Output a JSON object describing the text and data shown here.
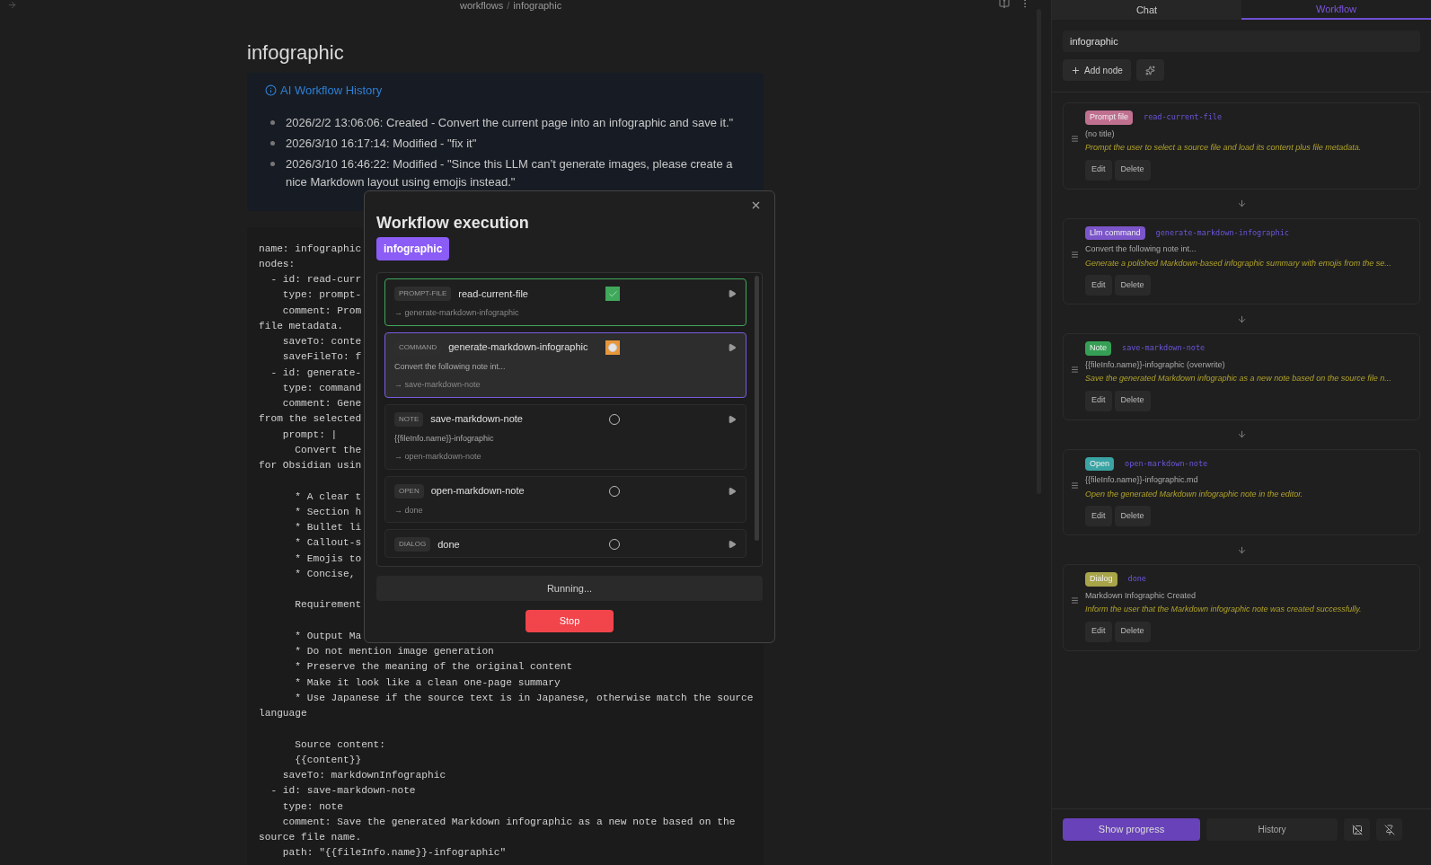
{
  "breadcrumb": {
    "folder": "workflows",
    "separator": "/",
    "file": "infographic"
  },
  "note": {
    "title": "infographic",
    "callout": {
      "title": "AI Workflow History",
      "items": [
        "2026/2/2 13:06:06: Created - Convert the current page into an infographic and save it.\"",
        "2026/3/10 16:17:14: Modified - \"fix it\"",
        "2026/3/10 16:46:22: Modified - \"Since this LLM can’t generate images, please create a nice Markdown layout using emojis instead.\""
      ]
    },
    "code_lines": [
      {
        "text": "name: infographic",
        "gap_before": false
      },
      {
        "text": "nodes:",
        "gap_before": false
      },
      {
        "text": "  - id: read-curr",
        "gap_before": false
      },
      {
        "text": "    type: prompt-",
        "gap_before": false
      },
      {
        "text": "    comment: Prom",
        "gap_before": false
      },
      {
        "text": "file metadata.",
        "gap_before": false
      },
      {
        "text": "    saveTo: conte",
        "gap_before": false
      },
      {
        "text": "    saveFileTo: f",
        "gap_before": false
      },
      {
        "text": "  - id: generate-",
        "gap_before": false
      },
      {
        "text": "    type: command",
        "gap_before": false
      },
      {
        "text": "    comment: Gene",
        "gap_before": false
      },
      {
        "text": "from the selected",
        "gap_before": false
      },
      {
        "text": "    prompt: |",
        "gap_before": false
      },
      {
        "text": "      Convert the",
        "gap_before": false
      },
      {
        "text": "for Obsidian usin",
        "gap_before": false
      },
      {
        "text": "      * A clear t",
        "gap_before": true
      },
      {
        "text": "      * Section h",
        "gap_before": false
      },
      {
        "text": "      * Bullet li",
        "gap_before": false
      },
      {
        "text": "      * Callout-s",
        "gap_before": false
      },
      {
        "text": "      * Emojis to",
        "gap_before": false
      },
      {
        "text": "      * Concise,",
        "gap_before": false
      },
      {
        "text": "      Requirement",
        "gap_before": true
      },
      {
        "text": "      * Output Ma",
        "gap_before": true
      },
      {
        "text": "      * Do not mention image generation",
        "gap_before": false
      },
      {
        "text": "      * Preserve the meaning of the original content",
        "gap_before": false
      },
      {
        "text": "      * Make it look like a clean one-page summary",
        "gap_before": false
      },
      {
        "text": "      * Use Japanese if the source text is in Japanese, otherwise match the source",
        "gap_before": false
      },
      {
        "text": "language",
        "gap_before": false
      },
      {
        "text": "      Source content:",
        "gap_before": true
      },
      {
        "text": "      {{content}}",
        "gap_before": false
      },
      {
        "text": "    saveTo: markdownInfographic",
        "gap_before": false
      },
      {
        "text": "  - id: save-markdown-note",
        "gap_before": false
      },
      {
        "text": "    type: note",
        "gap_before": false
      },
      {
        "text": "    comment: Save the generated Markdown infographic as a new note based on the",
        "gap_before": false
      },
      {
        "text": "source file name.",
        "gap_before": false
      },
      {
        "text": "    path: \"{{fileInfo.name}}-infographic\"",
        "gap_before": false
      }
    ]
  },
  "modal": {
    "title": "Workflow execution",
    "workflow": "infographic",
    "steps": [
      {
        "type": "PROMPT-FILE",
        "name": "read-current-file",
        "kind": "done",
        "next": "→ generate-markdown-infographic"
      },
      {
        "type": "COMMAND",
        "name": "generate-markdown-infographic",
        "kind": "running",
        "detail": "Convert the following note int...",
        "next": "→ save-markdown-note"
      },
      {
        "type": "NOTE",
        "name": "save-markdown-note",
        "kind": "pending",
        "detail": "{{fileInfo.name}}-infographic",
        "next": "→ open-markdown-note"
      },
      {
        "type": "OPEN",
        "name": "open-markdown-note",
        "kind": "pending",
        "next": "→ done"
      },
      {
        "type": "DIALOG",
        "name": "done",
        "kind": "pending"
      }
    ],
    "status": "Running...",
    "stop_button": "Stop"
  },
  "sidebar": {
    "tabs": [
      {
        "label": "Chat",
        "selected": false
      },
      {
        "label": "Workflow",
        "selected": true
      }
    ],
    "workflow_name": "infographic",
    "add_node_button": "Add node",
    "nodes": [
      {
        "badge": "Prompt file",
        "color": "#c0708f",
        "name": "read-current-file",
        "title": "(no title)",
        "comment": "Prompt the user to select a source file and load its content plus file metadata.",
        "edit": "Edit",
        "delete": "Delete"
      },
      {
        "badge": "Llm command",
        "color": "#7b55c9",
        "name": "generate-markdown-infographic",
        "title": "Convert the following note int...",
        "comment": "Generate a polished Markdown-based infographic summary with emojis from the se...",
        "edit": "Edit",
        "delete": "Delete"
      },
      {
        "badge": "Note",
        "color": "#35a055",
        "name": "save-markdown-note",
        "title": "{{fileInfo.name}}-infographic (overwrite)",
        "comment": "Save the generated Markdown infographic as a new note based on the source file n...",
        "edit": "Edit",
        "delete": "Delete"
      },
      {
        "badge": "Open",
        "color": "#3aa3a3",
        "name": "open-markdown-note",
        "title": "{{fileInfo.name}}-infographic.md",
        "comment": "Open the generated Markdown infographic note in the editor.",
        "edit": "Edit",
        "delete": "Delete"
      },
      {
        "badge": "Dialog",
        "color": "#a8a448",
        "name": "done",
        "title": "Markdown Infographic Created",
        "comment": "Inform the user that the Markdown infographic note was created successfully.",
        "edit": "Edit",
        "delete": "Delete"
      }
    ],
    "footer": {
      "progress_button": "Show progress",
      "history_button": "History"
    }
  }
}
